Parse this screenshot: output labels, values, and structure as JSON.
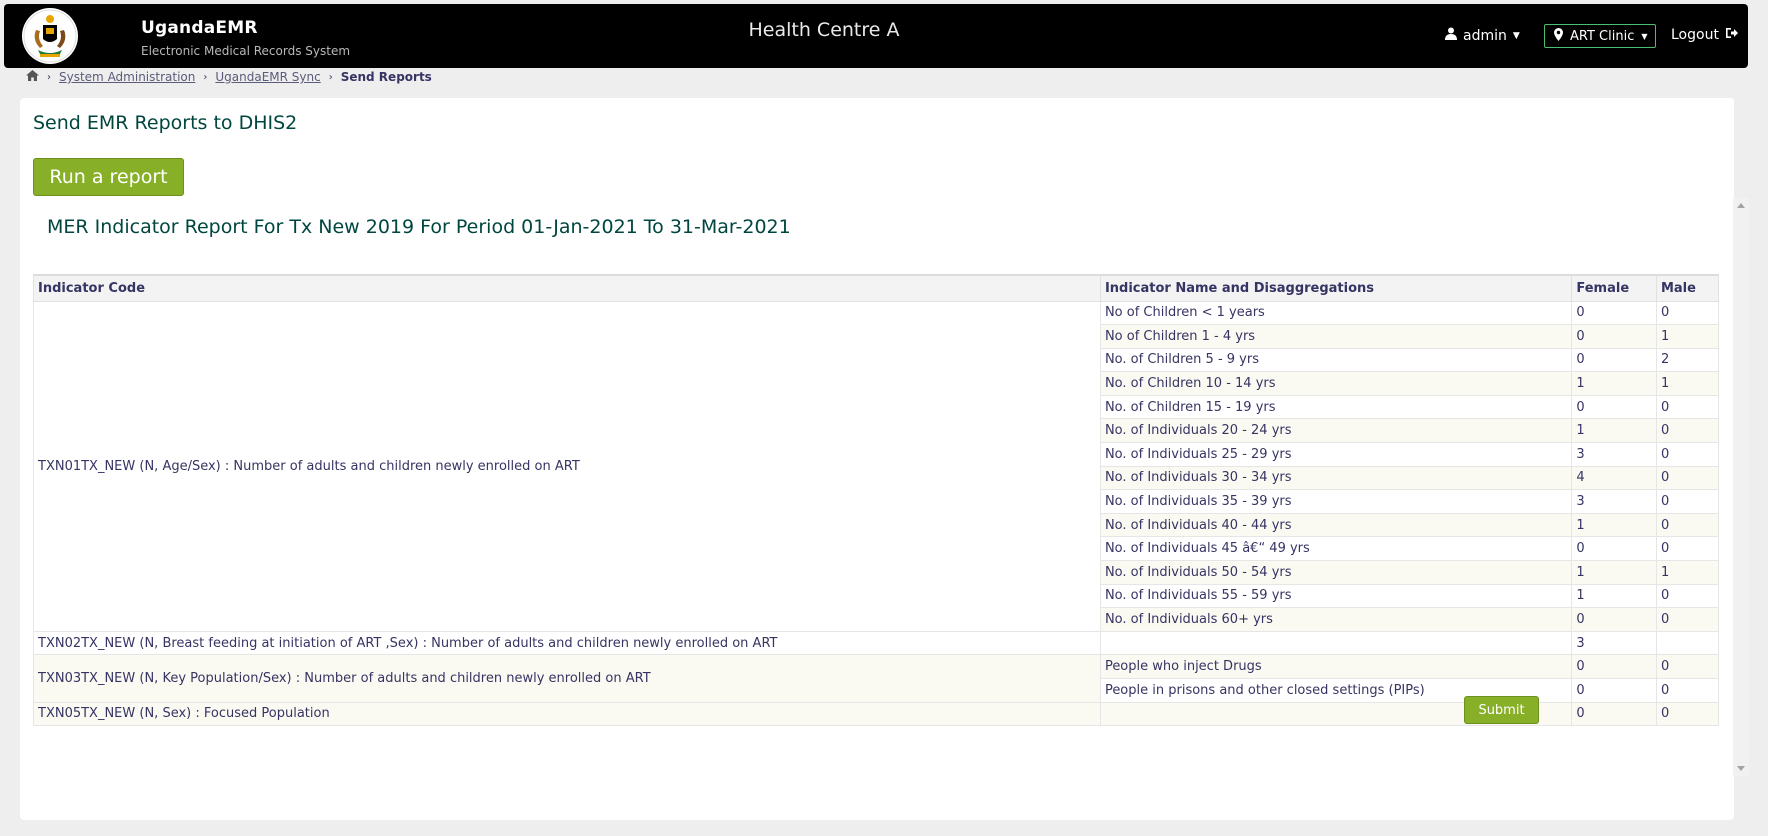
{
  "header": {
    "brand_title": "UgandaEMR",
    "brand_subtitle": "Electronic Medical Records System",
    "centre_name": "Health Centre A",
    "user": "admin",
    "location": "ART Clinic",
    "logout_label": "Logout"
  },
  "breadcrumb": {
    "items": [
      "System Administration",
      "UgandaEMR Sync"
    ],
    "current": "Send Reports"
  },
  "page": {
    "title": "Send EMR Reports to DHIS2",
    "run_button": "Run a report",
    "submit_button": "Submit"
  },
  "report": {
    "title": "MER Indicator Report For Tx New 2019 For Period 01-Jan-2021 To 31-Mar-2021",
    "columns": [
      "Indicator Code",
      "Indicator Name and Disaggregations",
      "Female",
      "Male"
    ],
    "codes": [
      "TXN01TX_NEW (N, Age/Sex) : Number of adults and children newly enrolled on ART",
      "TXN02TX_NEW (N, Breast feeding at initiation of ART ,Sex) : Number of adults and children newly enrolled on ART",
      "TXN03TX_NEW (N, Key Population/Sex) : Number of adults and children newly enrolled on ART",
      "TXN05TX_NEW (N, Sex) : Focused Population"
    ],
    "rows": [
      {
        "name": "No of Children < 1 years",
        "female": "0",
        "male": "0"
      },
      {
        "name": "No of Children 1 - 4 yrs",
        "female": "0",
        "male": "1"
      },
      {
        "name": "No. of Children 5 - 9 yrs",
        "female": "0",
        "male": "2"
      },
      {
        "name": "No. of Children 10 - 14 yrs",
        "female": "1",
        "male": "1"
      },
      {
        "name": "No. of Children 15 - 19 yrs",
        "female": "0",
        "male": "0"
      },
      {
        "name": "No. of Individuals 20 - 24 yrs",
        "female": "1",
        "male": "0"
      },
      {
        "name": "No. of Individuals 25 - 29 yrs",
        "female": "3",
        "male": "0"
      },
      {
        "name": "No. of Individuals 30 - 34 yrs",
        "female": "4",
        "male": "0"
      },
      {
        "name": "No. of Individuals 35 - 39 yrs",
        "female": "3",
        "male": "0"
      },
      {
        "name": "No. of Individuals 40 - 44 yrs",
        "female": "1",
        "male": "0"
      },
      {
        "name": "No. of Individuals 45 â€“ 49 yrs",
        "female": "0",
        "male": "0"
      },
      {
        "name": "No. of Individuals 50 - 54 yrs",
        "female": "1",
        "male": "1"
      },
      {
        "name": "No. of Individuals 55 - 59 yrs",
        "female": "1",
        "male": "0"
      },
      {
        "name": "No. of Individuals 60+ yrs",
        "female": "0",
        "male": "0"
      },
      {
        "name": "",
        "female": "3",
        "male": ""
      },
      {
        "name": "People who inject Drugs",
        "female": "0",
        "male": "0"
      },
      {
        "name": "People in prisons and other closed settings (PIPs)",
        "female": "0",
        "male": "0"
      },
      {
        "name": "",
        "female": "0",
        "male": "0"
      }
    ]
  },
  "icons": {
    "home": "home-icon",
    "user": "user-icon",
    "location": "map-marker-icon",
    "logout": "sign-out-icon"
  },
  "colors": {
    "header_bg": "#000000",
    "accent_green": "#88af28",
    "title_teal": "#00463f",
    "text": "#363463"
  }
}
